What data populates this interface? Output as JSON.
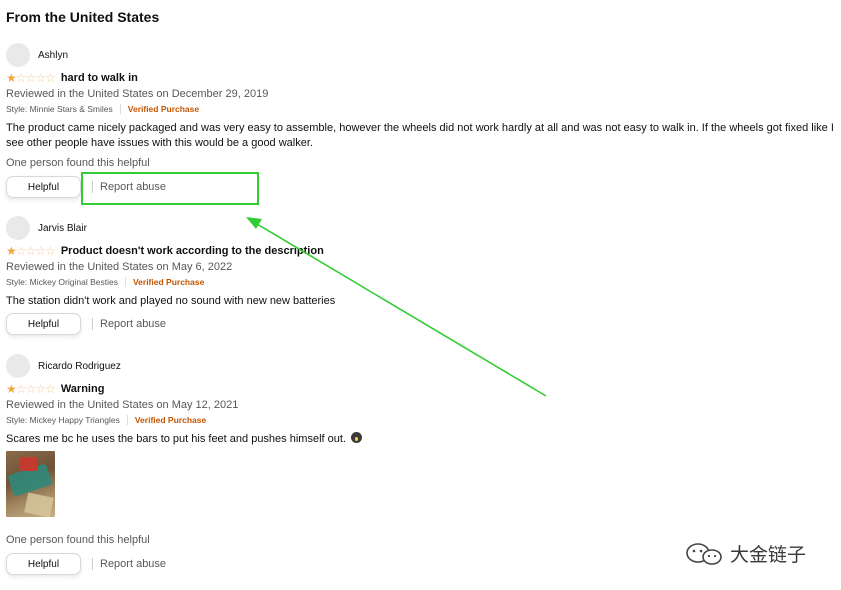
{
  "section_title": "From the United States",
  "rating_symbols": {
    "filled": "★",
    "empty": "☆"
  },
  "reviews": [
    {
      "reviewer": "Ashlyn",
      "stars": 1,
      "title": "hard to walk in",
      "date": "Reviewed in the United States on December 29, 2019",
      "style": "Style: Minnie Stars & Smiles",
      "verified": "Verified Purchase",
      "body": "The product came nicely packaged and was very easy to assemble, however the wheels did not work hardly at all and was not easy to walk in. If the wheels got fixed like I see other people have issues with this would be a good walker.",
      "helpful_count": "One person found this helpful",
      "helpful_label": "Helpful",
      "report_label": "Report abuse"
    },
    {
      "reviewer": "Jarvis Blair",
      "stars": 1,
      "title": "Product doesn't work according to the description",
      "date": "Reviewed in the United States on May 6, 2022",
      "style": "Style: Mickey Original Besties",
      "verified": "Verified Purchase",
      "body": "The station didn't work and played no sound with new new batteries",
      "helpful_label": "Helpful",
      "report_label": "Report abuse"
    },
    {
      "reviewer": "Ricardo Rodriguez",
      "stars": 1,
      "title": "Warning",
      "date": "Reviewed in the United States on May 12, 2021",
      "style": "Style: Mickey Happy Triangles",
      "verified": "Verified Purchase",
      "body": "Scares me bc he uses the bars to put his feet and pushes himself out.",
      "body_emoji": "face-screaming-emoji",
      "photo": "review-photo",
      "helpful_count": "One person found this helpful",
      "helpful_label": "Helpful",
      "report_label": "Report abuse"
    }
  ],
  "annotation": {
    "color": "#33cc33"
  },
  "watermark": {
    "text": "大金链子",
    "icon": "wechat-icon"
  },
  "colors": {
    "star": "#f2a742",
    "verified": "#c45500",
    "secondary_text": "#565959"
  }
}
